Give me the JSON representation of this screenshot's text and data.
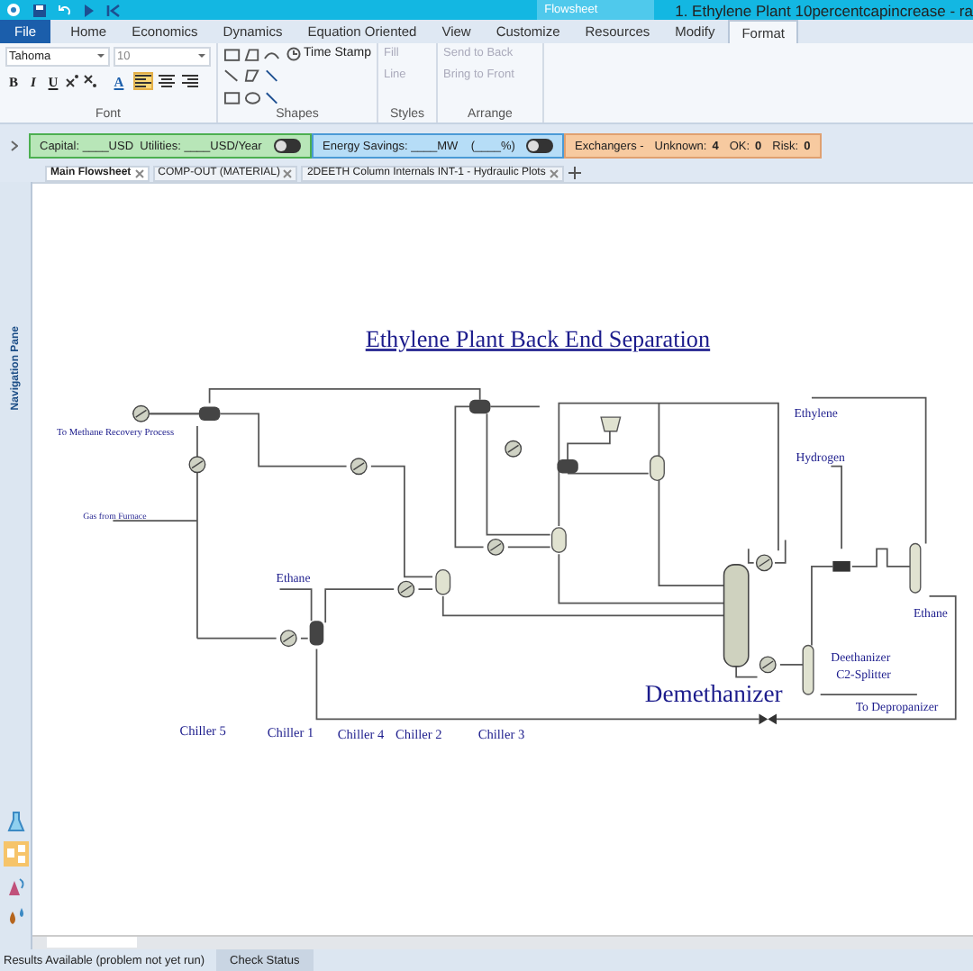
{
  "window": {
    "title": "1. Ethylene Plant 10percentcapincrease - ra",
    "context_tab": "Flowsheet"
  },
  "ribbon_tabs": [
    {
      "label": "File",
      "selected": false,
      "kind": "file"
    },
    {
      "label": "Home",
      "selected": false,
      "kind": "tab"
    },
    {
      "label": "Economics",
      "selected": false,
      "kind": "tab"
    },
    {
      "label": "Dynamics",
      "selected": false,
      "kind": "tab"
    },
    {
      "label": "Equation Oriented",
      "selected": false,
      "kind": "tab"
    },
    {
      "label": "View",
      "selected": false,
      "kind": "tab"
    },
    {
      "label": "Customize",
      "selected": false,
      "kind": "tab"
    },
    {
      "label": "Resources",
      "selected": false,
      "kind": "tab"
    },
    {
      "label": "Modify",
      "selected": false,
      "kind": "tab"
    },
    {
      "label": "Format",
      "selected": true,
      "kind": "tab"
    }
  ],
  "font_group": {
    "label": "Font",
    "font_name": "Tahoma",
    "font_size": "10",
    "style_buttons": [
      "B",
      "I",
      "U"
    ],
    "color_button": "A",
    "align_buttons": [
      {
        "selected": true
      },
      {
        "selected": false
      },
      {
        "selected": false
      }
    ]
  },
  "shapes_group": {
    "label": "Shapes",
    "time_stamp": "Time Stamp"
  },
  "styles_group": {
    "label": "Styles",
    "buttons": [
      {
        "label": "Fill",
        "disabled": true
      },
      {
        "label": "Line",
        "disabled": true
      }
    ]
  },
  "arrange_group": {
    "label": "Arrange",
    "buttons": [
      {
        "label": "Send to Back",
        "disabled": true
      },
      {
        "label": "Bring to Front",
        "disabled": true
      }
    ]
  },
  "analysis_bar": {
    "capital": {
      "text": "Capital: ____USD  Utilities: ____USD/Year",
      "on": false
    },
    "energy": {
      "text": "Energy Savings: ____MW    (____%)",
      "on": false
    },
    "exchangers": {
      "title": "Exchangers -",
      "unknown_label": "Unknown:",
      "unknown": "4",
      "ok_label": "OK:",
      "ok": "0",
      "risk_label": "Risk:",
      "risk": "0"
    }
  },
  "doc_tabs": [
    {
      "label": "Main Flowsheet",
      "selected": true
    },
    {
      "label": "COMP-OUT (MATERIAL)",
      "selected": false
    },
    {
      "label": "2DEETH Column Internals INT-1 - Hydraulic Plots",
      "selected": false
    }
  ],
  "navigation_pane": {
    "label": "Navigation Pane"
  },
  "flowsheet": {
    "title": "Ethylene Plant Back End Separation",
    "big_label": "Demethanizer",
    "labels": [
      "To Methane Recovery Process",
      "Gas from Furnace",
      "Ethane",
      "Chiller 5",
      "Chiller 1",
      "Chiller 4",
      "Chiller 2",
      "Chiller 3",
      "Ethylene",
      "Hydrogen",
      "Ethane",
      "Deethanizer",
      "C2-Splitter",
      "To Depropanizer"
    ]
  },
  "status_bar": {
    "message": "Results Available (problem not yet run)",
    "button": "Check Status"
  }
}
